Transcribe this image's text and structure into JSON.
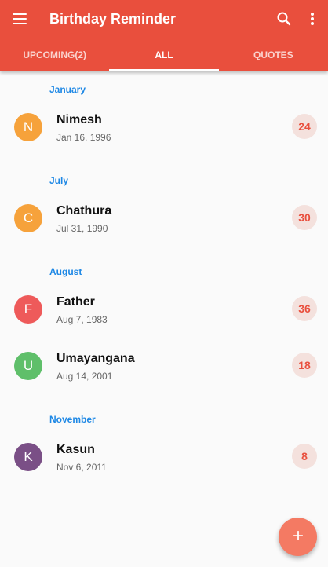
{
  "app": {
    "title": "Birthday Reminder",
    "icons": {
      "menu": "menu-icon",
      "search": "search-icon",
      "more": "more-vert-icon",
      "add": "add-icon"
    },
    "colors": {
      "primary": "#e94f3d",
      "accent": "#1e88e5",
      "fab": "#f47a63",
      "age_bg": "#f4e1dd"
    }
  },
  "tabs": [
    {
      "label": "UPCOMING(2)",
      "active": false
    },
    {
      "label": "ALL",
      "active": true
    },
    {
      "label": "QUOTES",
      "active": false
    }
  ],
  "sections": [
    {
      "month": "January",
      "people": [
        {
          "initial": "N",
          "name": "Nimesh",
          "date": "Jan 16, 1996",
          "age": "24",
          "color": "#f6a23b"
        }
      ]
    },
    {
      "month": "July",
      "people": [
        {
          "initial": "C",
          "name": "Chathura",
          "date": "Jul 31, 1990",
          "age": "30",
          "color": "#f6a23b"
        }
      ]
    },
    {
      "month": "August",
      "people": [
        {
          "initial": "F",
          "name": "Father",
          "date": "Aug 7, 1983",
          "age": "36",
          "color": "#ee5a5a"
        },
        {
          "initial": "U",
          "name": "Umayangana",
          "date": "Aug 14, 2001",
          "age": "18",
          "color": "#5fbf6a"
        }
      ]
    },
    {
      "month": "November",
      "people": [
        {
          "initial": "K",
          "name": "Kasun",
          "date": "Nov 6, 2011",
          "age": "8",
          "color": "#7a4f86"
        }
      ]
    }
  ],
  "fab": {
    "label": "+"
  }
}
